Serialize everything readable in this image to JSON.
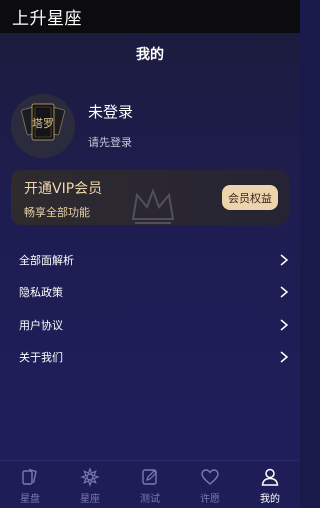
{
  "app": {
    "title": "上升星座"
  },
  "page": {
    "title": "我的"
  },
  "user": {
    "name": "未登录",
    "hint": "请先登录",
    "avatar_text": "塔罗"
  },
  "vip": {
    "title": "开通VIP会员",
    "subtitle": "畅享全部功能",
    "button": "会员权益"
  },
  "menu": [
    {
      "label": "全部面解析"
    },
    {
      "label": "隐私政策"
    },
    {
      "label": "用户协议"
    },
    {
      "label": "关于我们"
    }
  ],
  "tabs": [
    {
      "label": "星盘",
      "icon": "tarot-cards-icon"
    },
    {
      "label": "星座",
      "icon": "zodiac-icon"
    },
    {
      "label": "测试",
      "icon": "edit-icon"
    },
    {
      "label": "许愿",
      "icon": "heart-icon"
    },
    {
      "label": "我的",
      "icon": "user-icon",
      "active": true
    }
  ],
  "colors": {
    "background": "#1f1f5e",
    "vip_gold": "#eed3ad",
    "tab_inactive": "#7a7ab0",
    "tab_active": "#ffffff"
  }
}
